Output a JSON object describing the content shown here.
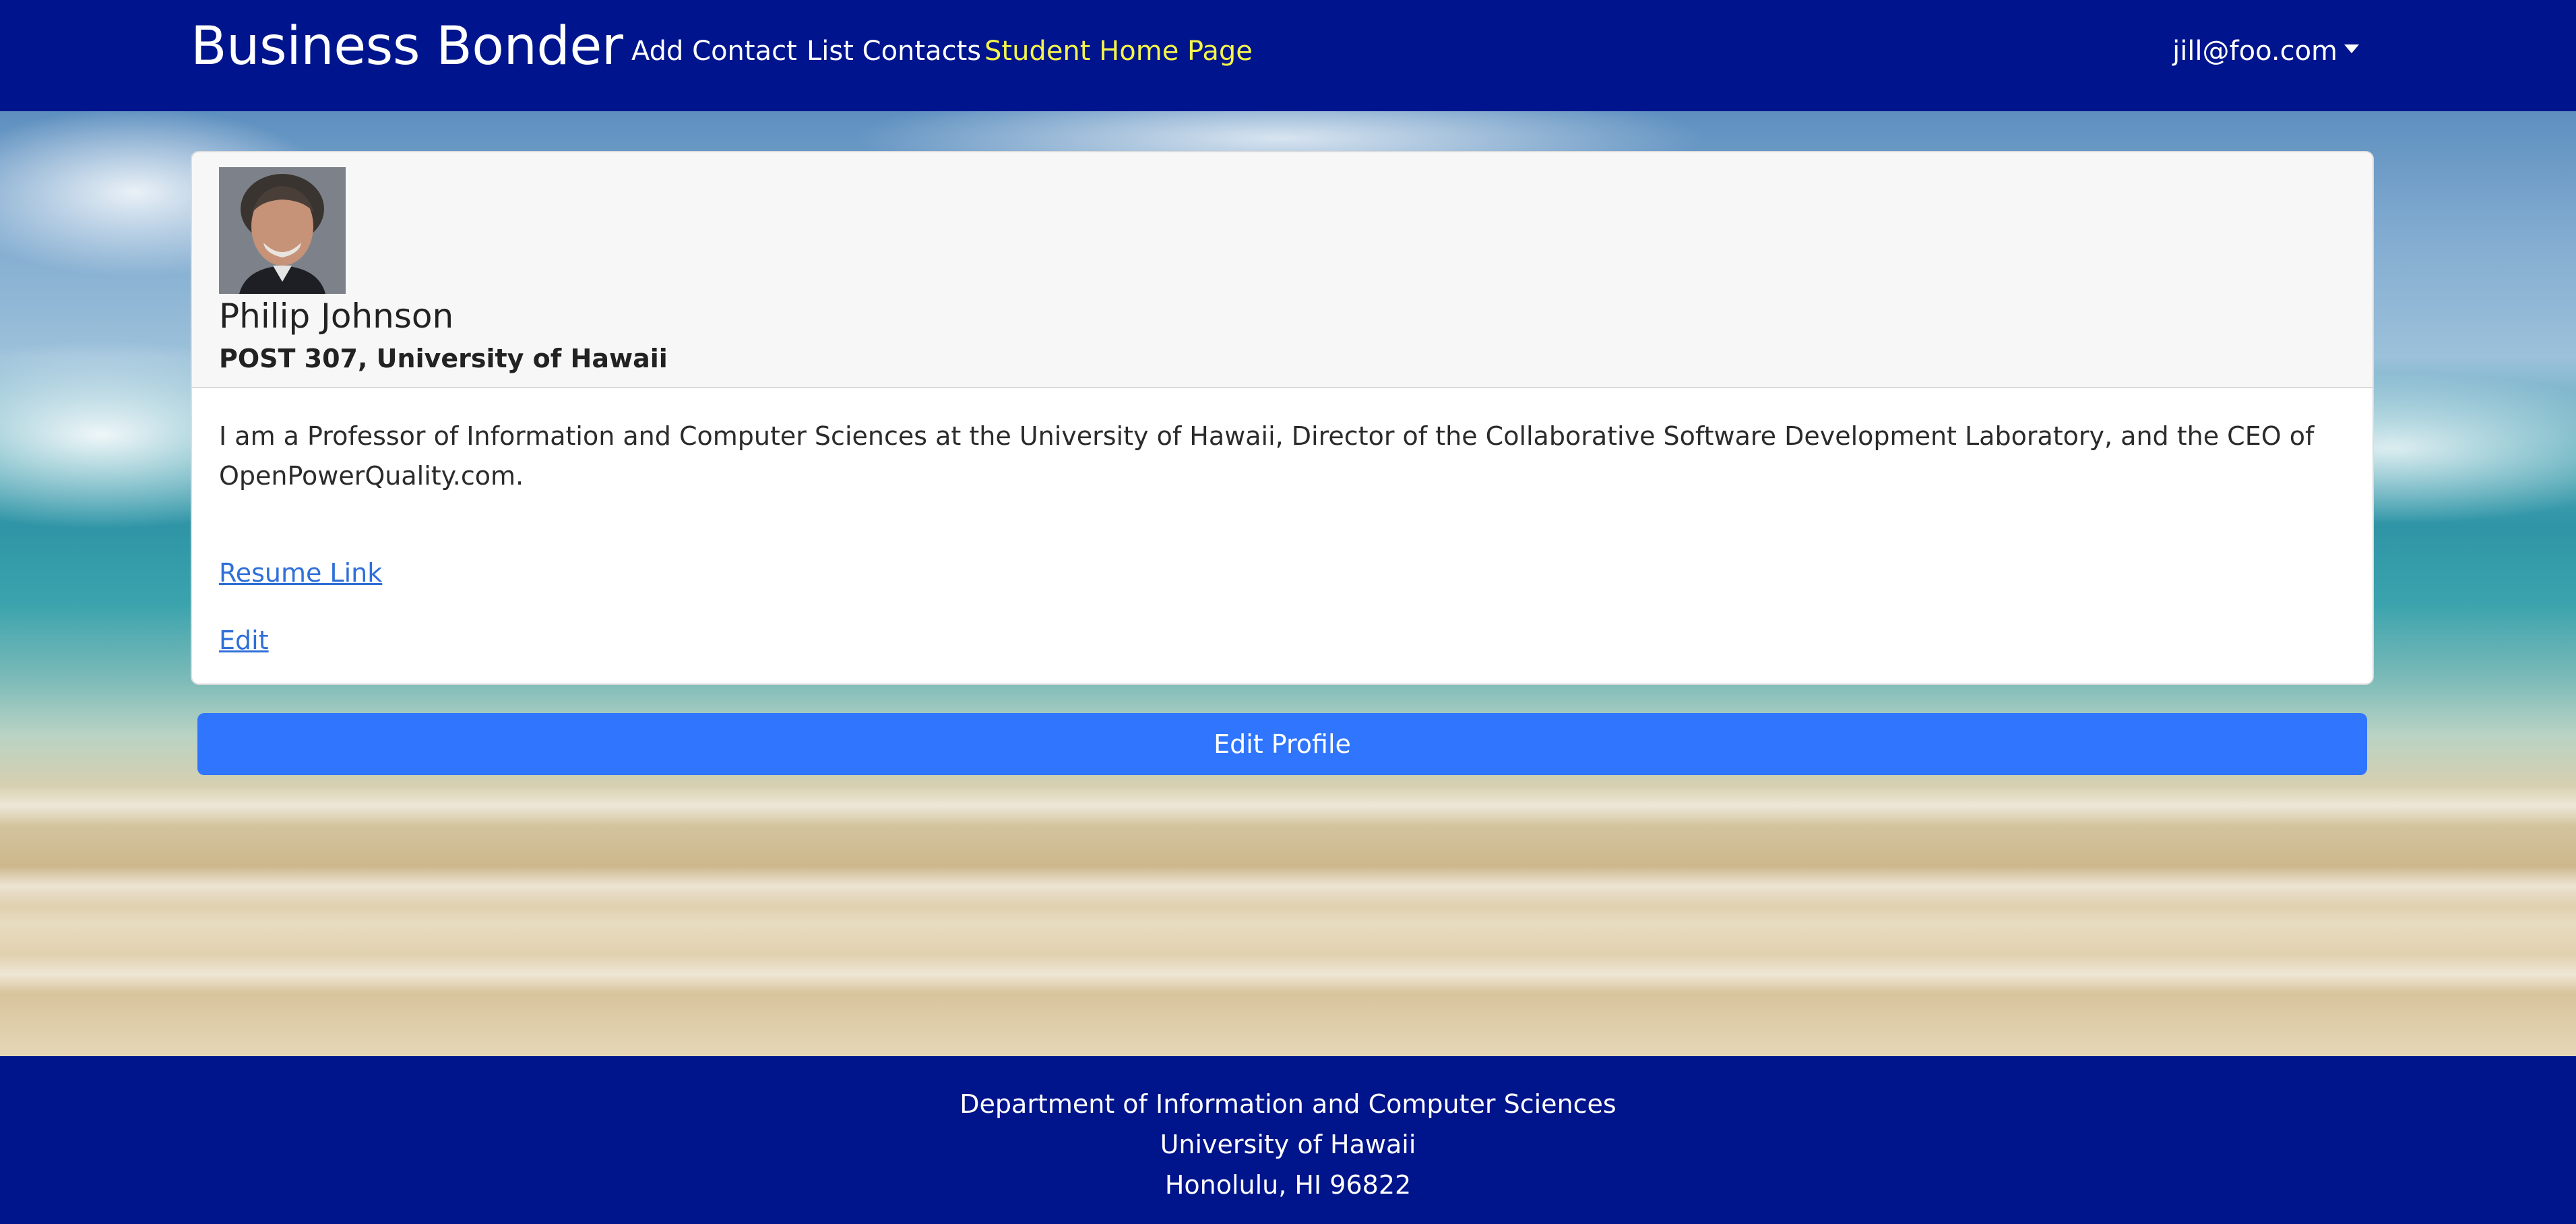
{
  "navbar": {
    "brand": "Business Bonder",
    "links": {
      "add_contact": "Add Contact",
      "list_contacts": "List Contacts",
      "student_home": "Student Home Page"
    },
    "user_email": "jill@foo.com"
  },
  "contact_card": {
    "name": "Philip Johnson",
    "address": "POST 307, University of Hawaii",
    "description": "I am a Professor of Information and Computer Sciences at the University of Hawaii, Director of the Collaborative Software Development Laboratory, and the CEO of OpenPowerQuality.com.",
    "resume_link": "Resume Link",
    "edit_link": "Edit"
  },
  "edit_profile_button": "Edit Profile",
  "footer": {
    "line1": "Department of Information and Computer Sciences",
    "line2": "University of Hawaii",
    "line3": "Honolulu, HI 96822"
  },
  "colors": {
    "navbar_bg": "#00158d",
    "active_link": "#f4f44a",
    "primary_button": "#2f75fe",
    "link": "#2f6fd8"
  }
}
